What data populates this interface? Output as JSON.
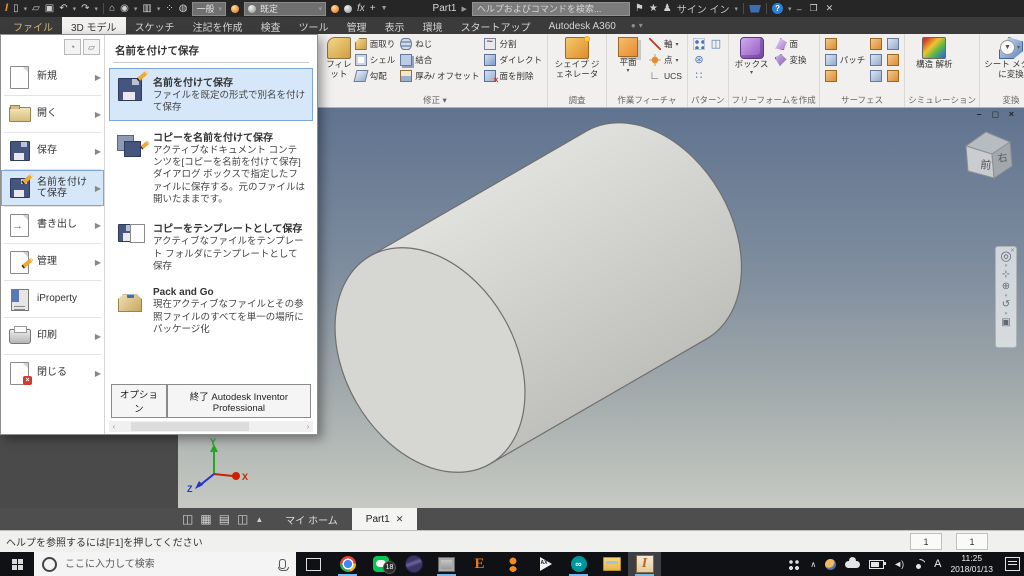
{
  "titlebar": {
    "doc_title": "Part1",
    "search_placeholder": "ヘルプおよびコマンドを検索...",
    "sign_in": "サイン イン",
    "material": "一般",
    "appearance": "既定",
    "fx": "fx"
  },
  "tabs": {
    "t0": "ファイル",
    "t1": "3D モデル",
    "t2": "スケッチ",
    "t3": "注記を作成",
    "t4": "検査",
    "t5": "ツール",
    "t6": "管理",
    "t7": "表示",
    "t8": "環境",
    "t9": "スタートアップ",
    "t10": "Autodesk A360"
  },
  "ribbon": {
    "modify": {
      "label": "修正",
      "big": "フィレット",
      "r0": "面取り",
      "r1": "シェル",
      "r2": "勾配",
      "r3": "ねじ",
      "r4": "結合",
      "r5": "厚み/ オフセット",
      "r6": "分割",
      "r7": "ダイレクト",
      "r8": "面を削除"
    },
    "investigate": {
      "label": "調査",
      "big": "シェイプ ジェネレータ"
    },
    "work": {
      "label": "作業フィーチャ",
      "big": "平面",
      "i0": "軸",
      "i1": "点",
      "i2": "UCS"
    },
    "pattern": {
      "label": "パターン"
    },
    "freeform": {
      "label": "フリーフォームを作成",
      "big": "ボックス",
      "i0": "面",
      "i1": "変換"
    },
    "surface": {
      "label": "サーフェス",
      "patch": "パッチ"
    },
    "simulation": {
      "label": "シミュレーション",
      "big": "構造 解析"
    },
    "convert": {
      "label": "変換",
      "big": "シート メタル に変換"
    }
  },
  "file_menu": {
    "s0": "新規",
    "s1": "開く",
    "s2": "保存",
    "s3": "名前を付けて保存",
    "s4": "書き出し",
    "s5": "管理",
    "s6": "iProperty",
    "s7": "印刷",
    "s8": "閉じる",
    "panel_header": "名前を付けて保存",
    "i0_title": "名前を付けて保存",
    "i0_desc": "ファイルを既定の形式で別名を付けて保存",
    "i1_title": "コピーを名前を付けて保存",
    "i1_desc": "アクティブなドキュメント コンテンツを[コピーを名前を付けて保存]ダイアログ ボックスで指定したファイルに保存する。元のファイルは開いたままです。",
    "i2_title": "コピーをテンプレートとして保存",
    "i2_desc": "アクティブなファイルをテンプレート フォルダにテンプレートとして保存",
    "i3_title": "Pack and Go",
    "i3_desc": "現在アクティブなファイルとその参照ファイルのすべてを単一の場所にパッケージ化",
    "options_button": "オプション",
    "exit_button": "終了 Autodesk Inventor Professional"
  },
  "viewport": {
    "viewcube_front": "前",
    "viewcube_right": "右",
    "triad_x": "X",
    "triad_y": "Y",
    "triad_z": "Z"
  },
  "doctabs": {
    "home": "マイ ホーム",
    "active": "Part1"
  },
  "statusbar": {
    "help": "ヘルプを参照するには[F1]を押してください",
    "box1": "1",
    "box2": "1"
  },
  "taskbar": {
    "search_placeholder": "ここに入力して検索",
    "line_badge": "18",
    "e_label": "E",
    "ax_label": "AX",
    "ime": "A",
    "time": "11:25",
    "date": "2018/01/13"
  }
}
